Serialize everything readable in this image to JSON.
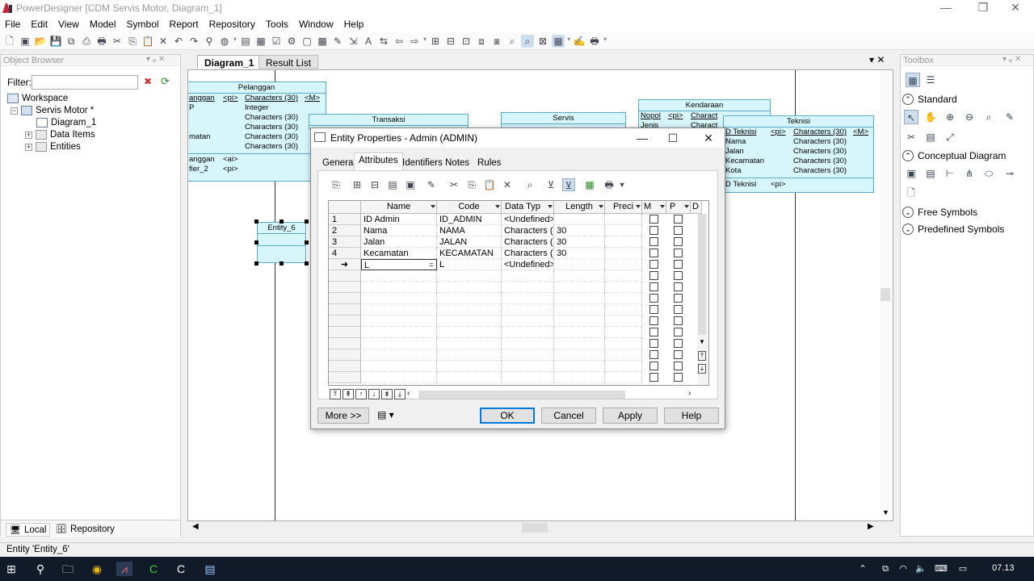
{
  "window": {
    "title": "PowerDesigner [CDM Servis Motor, Diagram_1]"
  },
  "menubar": {
    "items": [
      "File",
      "Edit",
      "View",
      "Model",
      "Symbol",
      "Report",
      "Repository",
      "Tools",
      "Window",
      "Help"
    ]
  },
  "object_browser": {
    "header": "Object Browser",
    "filter_label": "Filter:",
    "filter_value": "",
    "tree": {
      "workspace": "Workspace",
      "model": "Servis Motor *",
      "diagram": "Diagram_1",
      "data_items": "Data Items",
      "entities": "Entities"
    },
    "tabs": {
      "local": "Local",
      "repository": "Repository"
    }
  },
  "diagram": {
    "tabs": {
      "diagram": "Diagram_1",
      "result_list": "Result List"
    },
    "entities": {
      "pelanggan": {
        "title": "Pelanggan",
        "rows": [
          [
            "anggan",
            "<pi>",
            "Characters (30)",
            "<M>"
          ],
          [
            "P",
            "",
            "Integer",
            ""
          ],
          [
            "",
            "",
            "Characters (30)",
            ""
          ],
          [
            "",
            "",
            "Characters (30)",
            ""
          ],
          [
            "matan",
            "",
            "Characters (30)",
            ""
          ],
          [
            "",
            "",
            "Characters (30)",
            ""
          ]
        ],
        "id_rows": [
          [
            "anggan",
            "<ai>"
          ],
          [
            "fier_2",
            "<pi>"
          ]
        ]
      },
      "transaksi": {
        "title": "Transaksi"
      },
      "servis": {
        "title": "Servis"
      },
      "kendaraan": {
        "title": "Kendaraan",
        "rows": [
          [
            "Nopol",
            "<pi>",
            "Charact"
          ],
          [
            "Jenis",
            "",
            "Charact"
          ]
        ]
      },
      "teknisi": {
        "title": "Teknisi",
        "rows": [
          [
            "D Teknisi",
            "<pi>",
            "Characters (30)",
            "<M>"
          ],
          [
            "Nama",
            "",
            "Characters (30)",
            ""
          ],
          [
            "Jalan",
            "",
            "Characters (30)",
            ""
          ],
          [
            "Kecamatan",
            "",
            "Characters (30)",
            ""
          ],
          [
            "Kota",
            "",
            "Characters (30)",
            ""
          ]
        ],
        "id_row": [
          "D Teknisi",
          "<pi>"
        ]
      },
      "entity6": {
        "title": "Entity_6"
      }
    }
  },
  "toolbox": {
    "header": "Toolbox",
    "sections": {
      "standard": "Standard",
      "conceptual": "Conceptual Diagram",
      "free": "Free Symbols",
      "predefined": "Predefined Symbols"
    }
  },
  "dialog": {
    "title": "Entity Properties - Admin (ADMIN)",
    "tabs": [
      "General",
      "Attributes",
      "Identifiers",
      "Notes",
      "Rules"
    ],
    "active_tab": "Attributes",
    "columns": [
      "Name",
      "Code",
      "Data Typ",
      "Length",
      "Preci",
      "M",
      "P",
      "D"
    ],
    "rows": [
      {
        "num": "1",
        "name": "ID Admin",
        "code": "ID_ADMIN",
        "type": "<Undefined>",
        "length": ""
      },
      {
        "num": "2",
        "name": "Nama",
        "code": "NAMA",
        "type": "Characters (3",
        "length": "30"
      },
      {
        "num": "3",
        "name": "Jalan",
        "code": "JALAN",
        "type": "Characters (3",
        "length": "30"
      },
      {
        "num": "4",
        "name": "Kecamatan",
        "code": "KECAMATAN",
        "type": "Characters (3",
        "length": "30"
      },
      {
        "num": "➜",
        "name": "L",
        "code": "L",
        "type": "<Undefined>",
        "length": ""
      }
    ],
    "buttons": {
      "more": "More >>",
      "ok": "OK",
      "cancel": "Cancel",
      "apply": "Apply",
      "help": "Help"
    }
  },
  "statusbar": {
    "text": "Entity 'Entity_6'"
  },
  "taskbar": {
    "clock": "07.13"
  }
}
